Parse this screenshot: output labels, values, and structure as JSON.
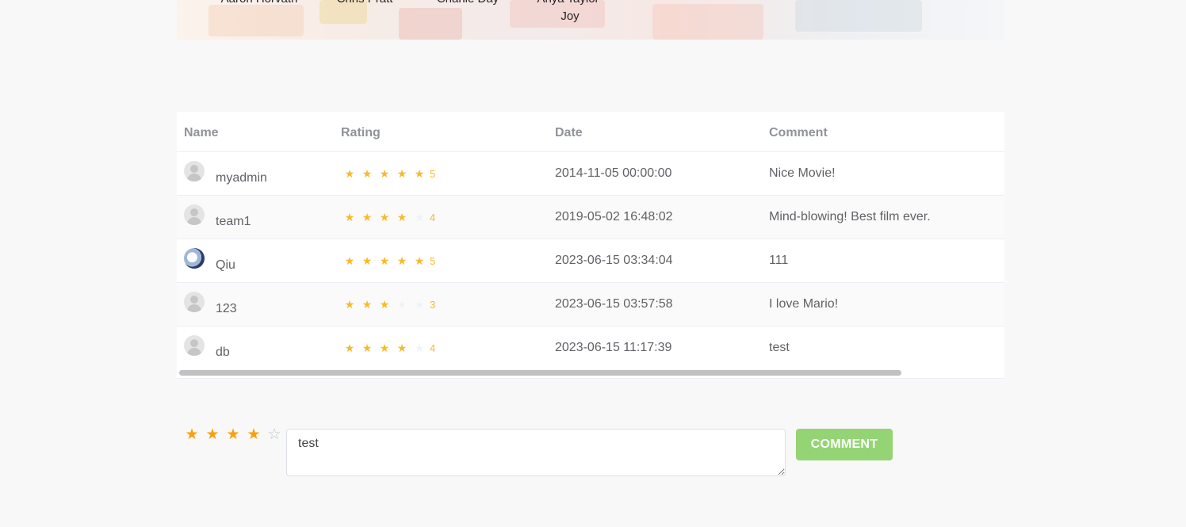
{
  "cast": [
    {
      "name": "Aaron Horvath"
    },
    {
      "name": "Chris Pratt"
    },
    {
      "name": "Charlie Day"
    },
    {
      "name": "Anya Taylor-Joy"
    }
  ],
  "reviews": {
    "columns": [
      "Name",
      "Rating",
      "Date",
      "Comment"
    ],
    "rows": [
      {
        "name": "myadmin",
        "rating": 5,
        "rating_label": "5",
        "date": "2014-11-05 00:00:00",
        "comment": "Nice Movie!",
        "avatar": "default"
      },
      {
        "name": "team1",
        "rating": 4,
        "rating_label": "4",
        "date": "2019-05-02 16:48:02",
        "comment": "Mind-blowing! Best film ever.",
        "avatar": "default"
      },
      {
        "name": "Qiu",
        "rating": 5,
        "rating_label": "5",
        "date": "2023-06-15 03:34:04",
        "comment": "111",
        "avatar": "photo"
      },
      {
        "name": "123",
        "rating": 3,
        "rating_label": "3",
        "date": "2023-06-15 03:57:58",
        "comment": "I love Mario!",
        "avatar": "default"
      },
      {
        "name": "db",
        "rating": 4,
        "rating_label": "4",
        "date": "2023-06-15 11:17:39",
        "comment": "test",
        "avatar": "default"
      }
    ],
    "max_rating": 5
  },
  "comment_form": {
    "rating": 4,
    "max_rating": 5,
    "comment_value": "test",
    "submit_label": "COMMENT"
  },
  "colors": {
    "star_active": "#f7ba2a",
    "star_input_active": "#f7a010",
    "button_bg": "#95d475",
    "header_text": "#909399"
  },
  "icons": {
    "star": "★",
    "star_empty": "☆",
    "avatar": "user-avatar-icon"
  }
}
